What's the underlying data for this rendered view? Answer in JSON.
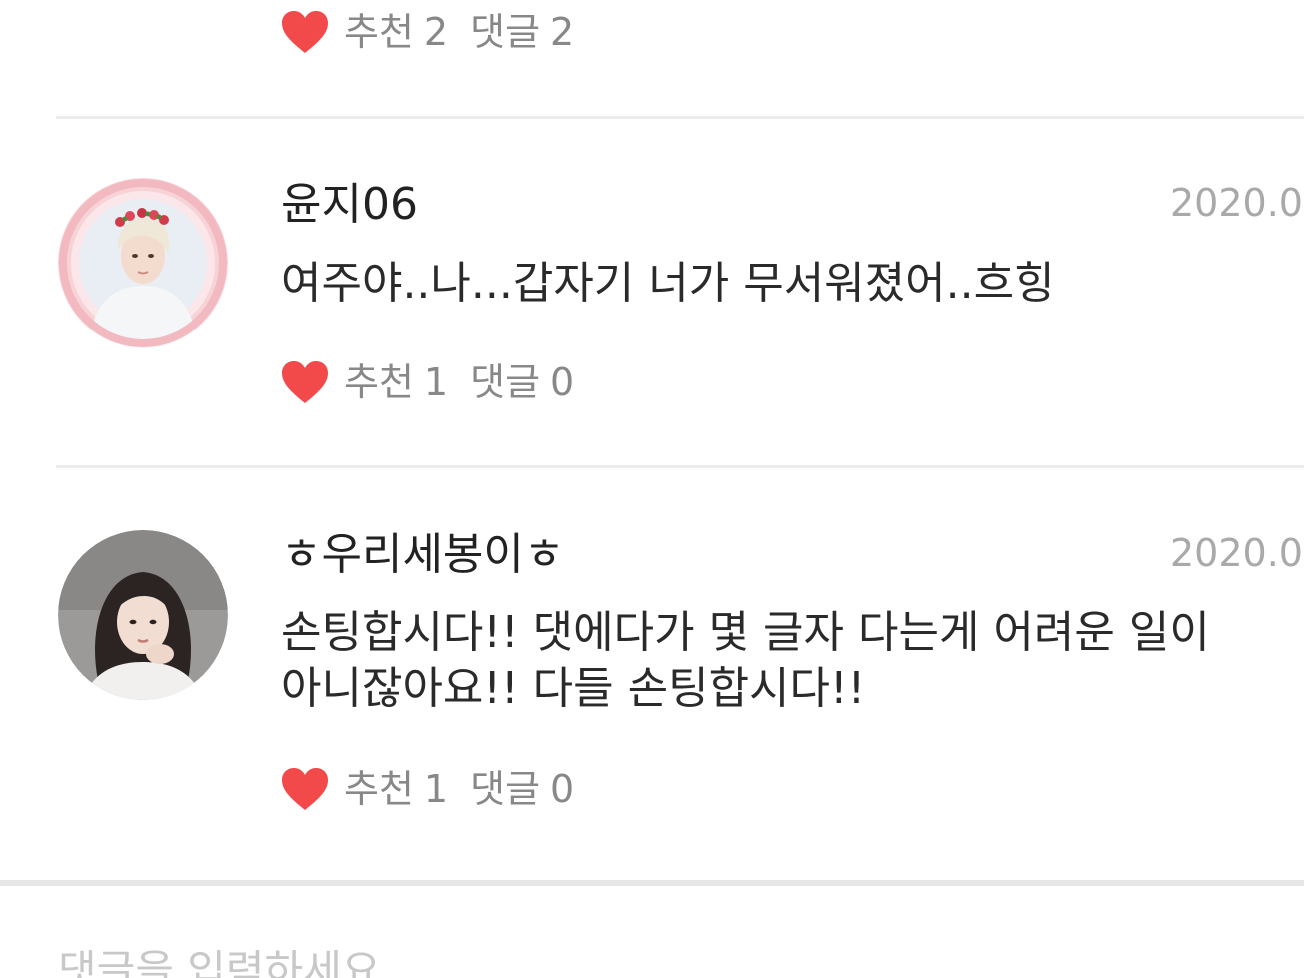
{
  "colors": {
    "heart": "#f24a4a",
    "divider": "#ebebeb",
    "date": "#a9a9a9",
    "meta": "#888888"
  },
  "top_stats": {
    "like_label": "추천",
    "like_count": "2",
    "reply_label": "댓글",
    "reply_count": "2"
  },
  "comments": [
    {
      "author": "윤지06",
      "date": "2020.0",
      "text": "여주야..나...갑자기 너가 무서워졌어..흐힝",
      "like_label": "추천",
      "like_count": "1",
      "reply_label": "댓글",
      "reply_count": "0",
      "avatar_icon": "avatar-flower-crown-photo"
    },
    {
      "author": "ㅎ우리세봉이ㅎ",
      "date": "2020.0",
      "text": "손팅합시다!! 댓에다가 몇 글자 다는게 어려운 일이\n아니잖아요!! 다들 손팅합시다!!",
      "like_label": "추천",
      "like_count": "1",
      "reply_label": "댓글",
      "reply_count": "0",
      "avatar_icon": "avatar-portrait-photo"
    }
  ],
  "input": {
    "placeholder": "댓글을 입력하세요"
  }
}
